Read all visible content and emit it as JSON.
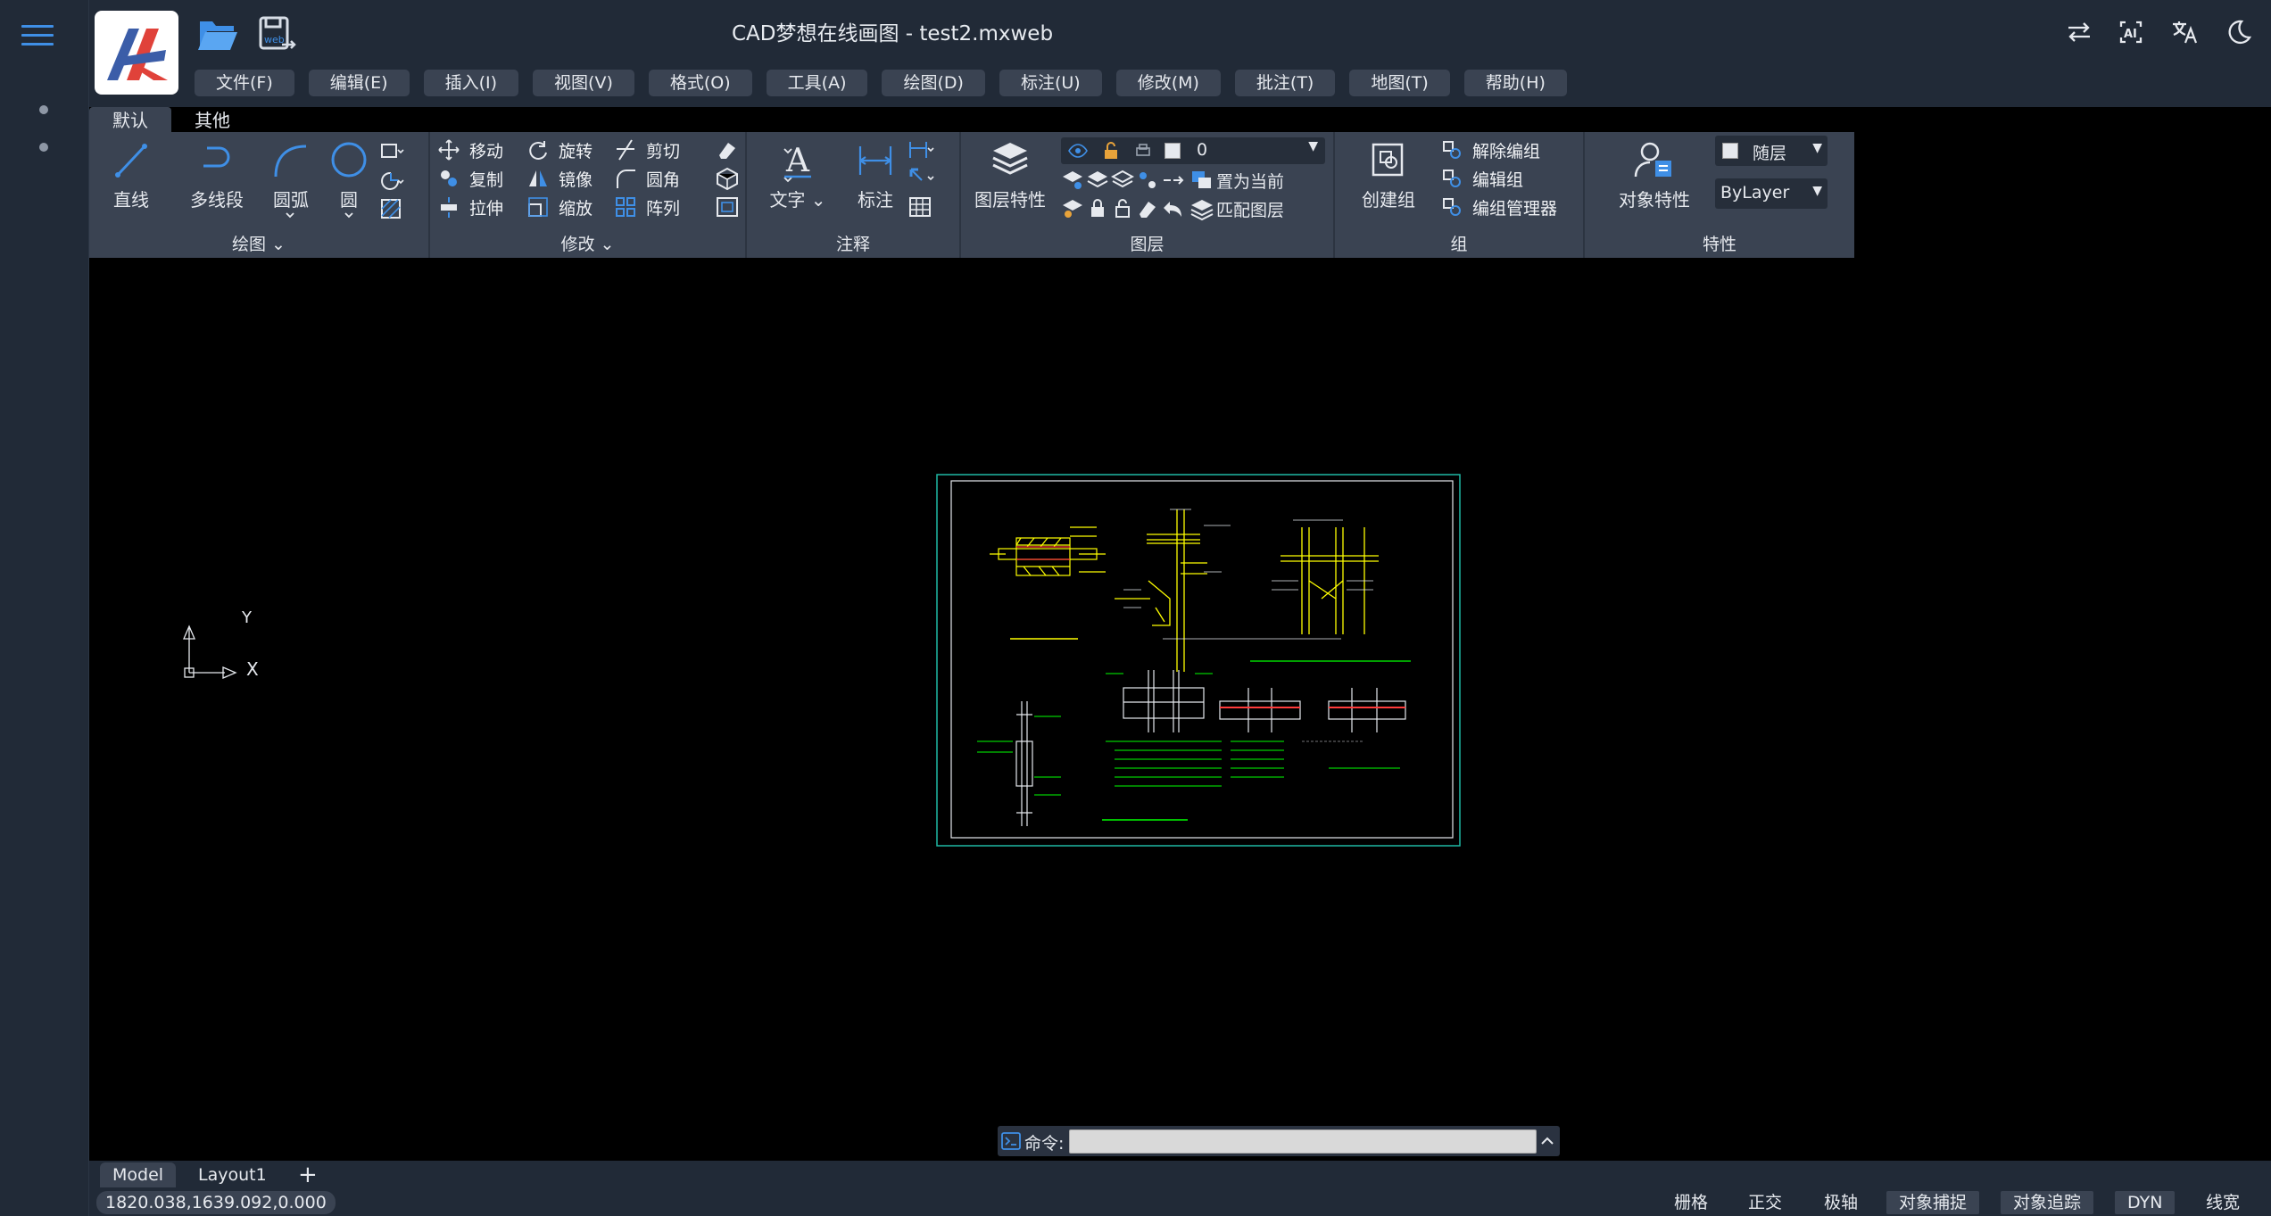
{
  "header": {
    "title": "CAD梦想在线画图 - test2.mxweb"
  },
  "menu": [
    "文件(F)",
    "编辑(E)",
    "插入(I)",
    "视图(V)",
    "格式(O)",
    "工具(A)",
    "绘图(D)",
    "标注(U)",
    "修改(M)",
    "批注(T)",
    "地图(T)",
    "帮助(H)"
  ],
  "ribbon_tabs": [
    "默认",
    "其他"
  ],
  "ribbon": {
    "draw": {
      "title": "绘图",
      "line": "直线",
      "polyline": "多线段",
      "arc": "圆弧",
      "circle": "圆"
    },
    "modify": {
      "title": "修改",
      "move": "移动",
      "rotate": "旋转",
      "trim": "剪切",
      "copy": "复制",
      "mirror": "镜像",
      "fillet": "圆角",
      "stretch": "拉伸",
      "scale": "缩放",
      "array": "阵列"
    },
    "annotation": {
      "title": "注释",
      "text": "文字",
      "dimension": "标注"
    },
    "layers": {
      "title": "图层",
      "layer_properties": "图层特性",
      "current_layer": "0",
      "set_current": "置为当前",
      "match_layer": "匹配图层"
    },
    "group": {
      "title": "组",
      "create_group": "创建组",
      "ungroup": "解除编组",
      "edit_group": "编辑组",
      "group_manager": "编组管理器"
    },
    "properties": {
      "title": "特性",
      "object_properties": "对象特性",
      "color_value": "随层",
      "linetype_value": "ByLayer"
    }
  },
  "command": {
    "label": "命令:",
    "value": ""
  },
  "ucs": {
    "x_label": "X",
    "y_label": "Y"
  },
  "layouts": {
    "model": "Model",
    "layout1": "Layout1",
    "add": "+"
  },
  "status": {
    "coords": "1820.038,1639.092,0.000",
    "toggles": [
      {
        "label": "栅格",
        "on": false
      },
      {
        "label": "正交",
        "on": false
      },
      {
        "label": "极轴",
        "on": false
      },
      {
        "label": "对象捕捉",
        "on": true
      },
      {
        "label": "对象追踪",
        "on": true
      },
      {
        "label": "DYN",
        "on": true
      },
      {
        "label": "线宽",
        "on": false
      }
    ]
  },
  "colors": {
    "accent": "#3f8fe6",
    "panel": "#3a4352",
    "chrome": "#212a37",
    "drawing_yellow": "#ffff00",
    "drawing_green": "#00ff00"
  }
}
